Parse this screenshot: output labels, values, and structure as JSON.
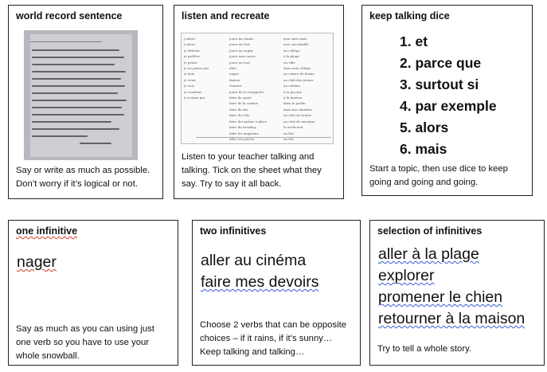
{
  "cards": [
    {
      "id": "world-record",
      "title": "world record sentence",
      "photo_caption": "world record sentence",
      "desc_lines": [
        "Say or write as much as possible.",
        "Don’t worry if it’s logical or not."
      ]
    },
    {
      "id": "listen-recreate",
      "title": "listen and recreate",
      "desc_lines": [
        "Listen to your teacher talking and",
        "talking. Tick on the sheet what they",
        "say. Try to say it all back."
      ],
      "sheet": {
        "col1": [
          "j'adore",
          "j'adore",
          "je déteste",
          "je préfère",
          "je pense",
          "je ne pense pas",
          "je dois",
          "je veux",
          "je vais",
          "je voudrais",
          "je n'aime pas"
        ],
        "col2": [
          "jouer au tennis",
          "jouer au foot",
          "jouer au rugby",
          "jouer aux cartes",
          "jouer au foot",
          "aller",
          "nager",
          "danser",
          "chanter",
          "jouer de la trompette",
          "faire du sport",
          "faire de la cuisine",
          "faire du ski",
          "faire du vélo",
          "faire des patins à glace",
          "faire du bowling",
          "faire les magasins",
          "aller à la pêche",
          "faire des devoirs",
          "faire du camping"
        ],
        "col3": [
          "avec mes amis",
          "avec ma famille",
          "au collège",
          "à la plage",
          "en ville",
          "dans mon village",
          "au centre de loisirs",
          "au club des jeunes",
          "au cinéma",
          "à la piscine",
          "à la maison",
          "dans le jardin",
          "dans ma chambre",
          "au club de tennis",
          "au club de musique",
          "le week-end",
          "au lité",
          "en été",
          "pour rire",
          "normalement"
        ]
      }
    },
    {
      "id": "keep-talking",
      "title": "keep talking dice",
      "dice": [
        "1. et",
        "2. parce que",
        "3. surtout si",
        "4. par exemple",
        "5. alors",
        "6. mais"
      ],
      "desc_lines": [
        "Start a topic, then use dice to keep",
        "going and going and going."
      ]
    },
    {
      "id": "one-infinitive",
      "title": "one infinitive",
      "words": [
        "nager"
      ],
      "desc_lines": [
        "Say as much as you can using just",
        "one verb so you have to use your",
        "whole snowball."
      ]
    },
    {
      "id": "two-infinitives",
      "title": "two infinitives",
      "words": [
        "aller au cinéma",
        "faire mes devoirs"
      ],
      "desc_lines": [
        "Choose 2 verbs that can be opposite",
        "choices – if it rains, if it’s sunny…",
        "Keep talking and talking…"
      ]
    },
    {
      "id": "selection",
      "title": "selection of infinitives",
      "words": [
        "aller à la plage",
        "explorer",
        "promener le chien",
        "retourner à la maison"
      ],
      "desc_lines": [
        "Try to tell a whole story."
      ]
    }
  ]
}
